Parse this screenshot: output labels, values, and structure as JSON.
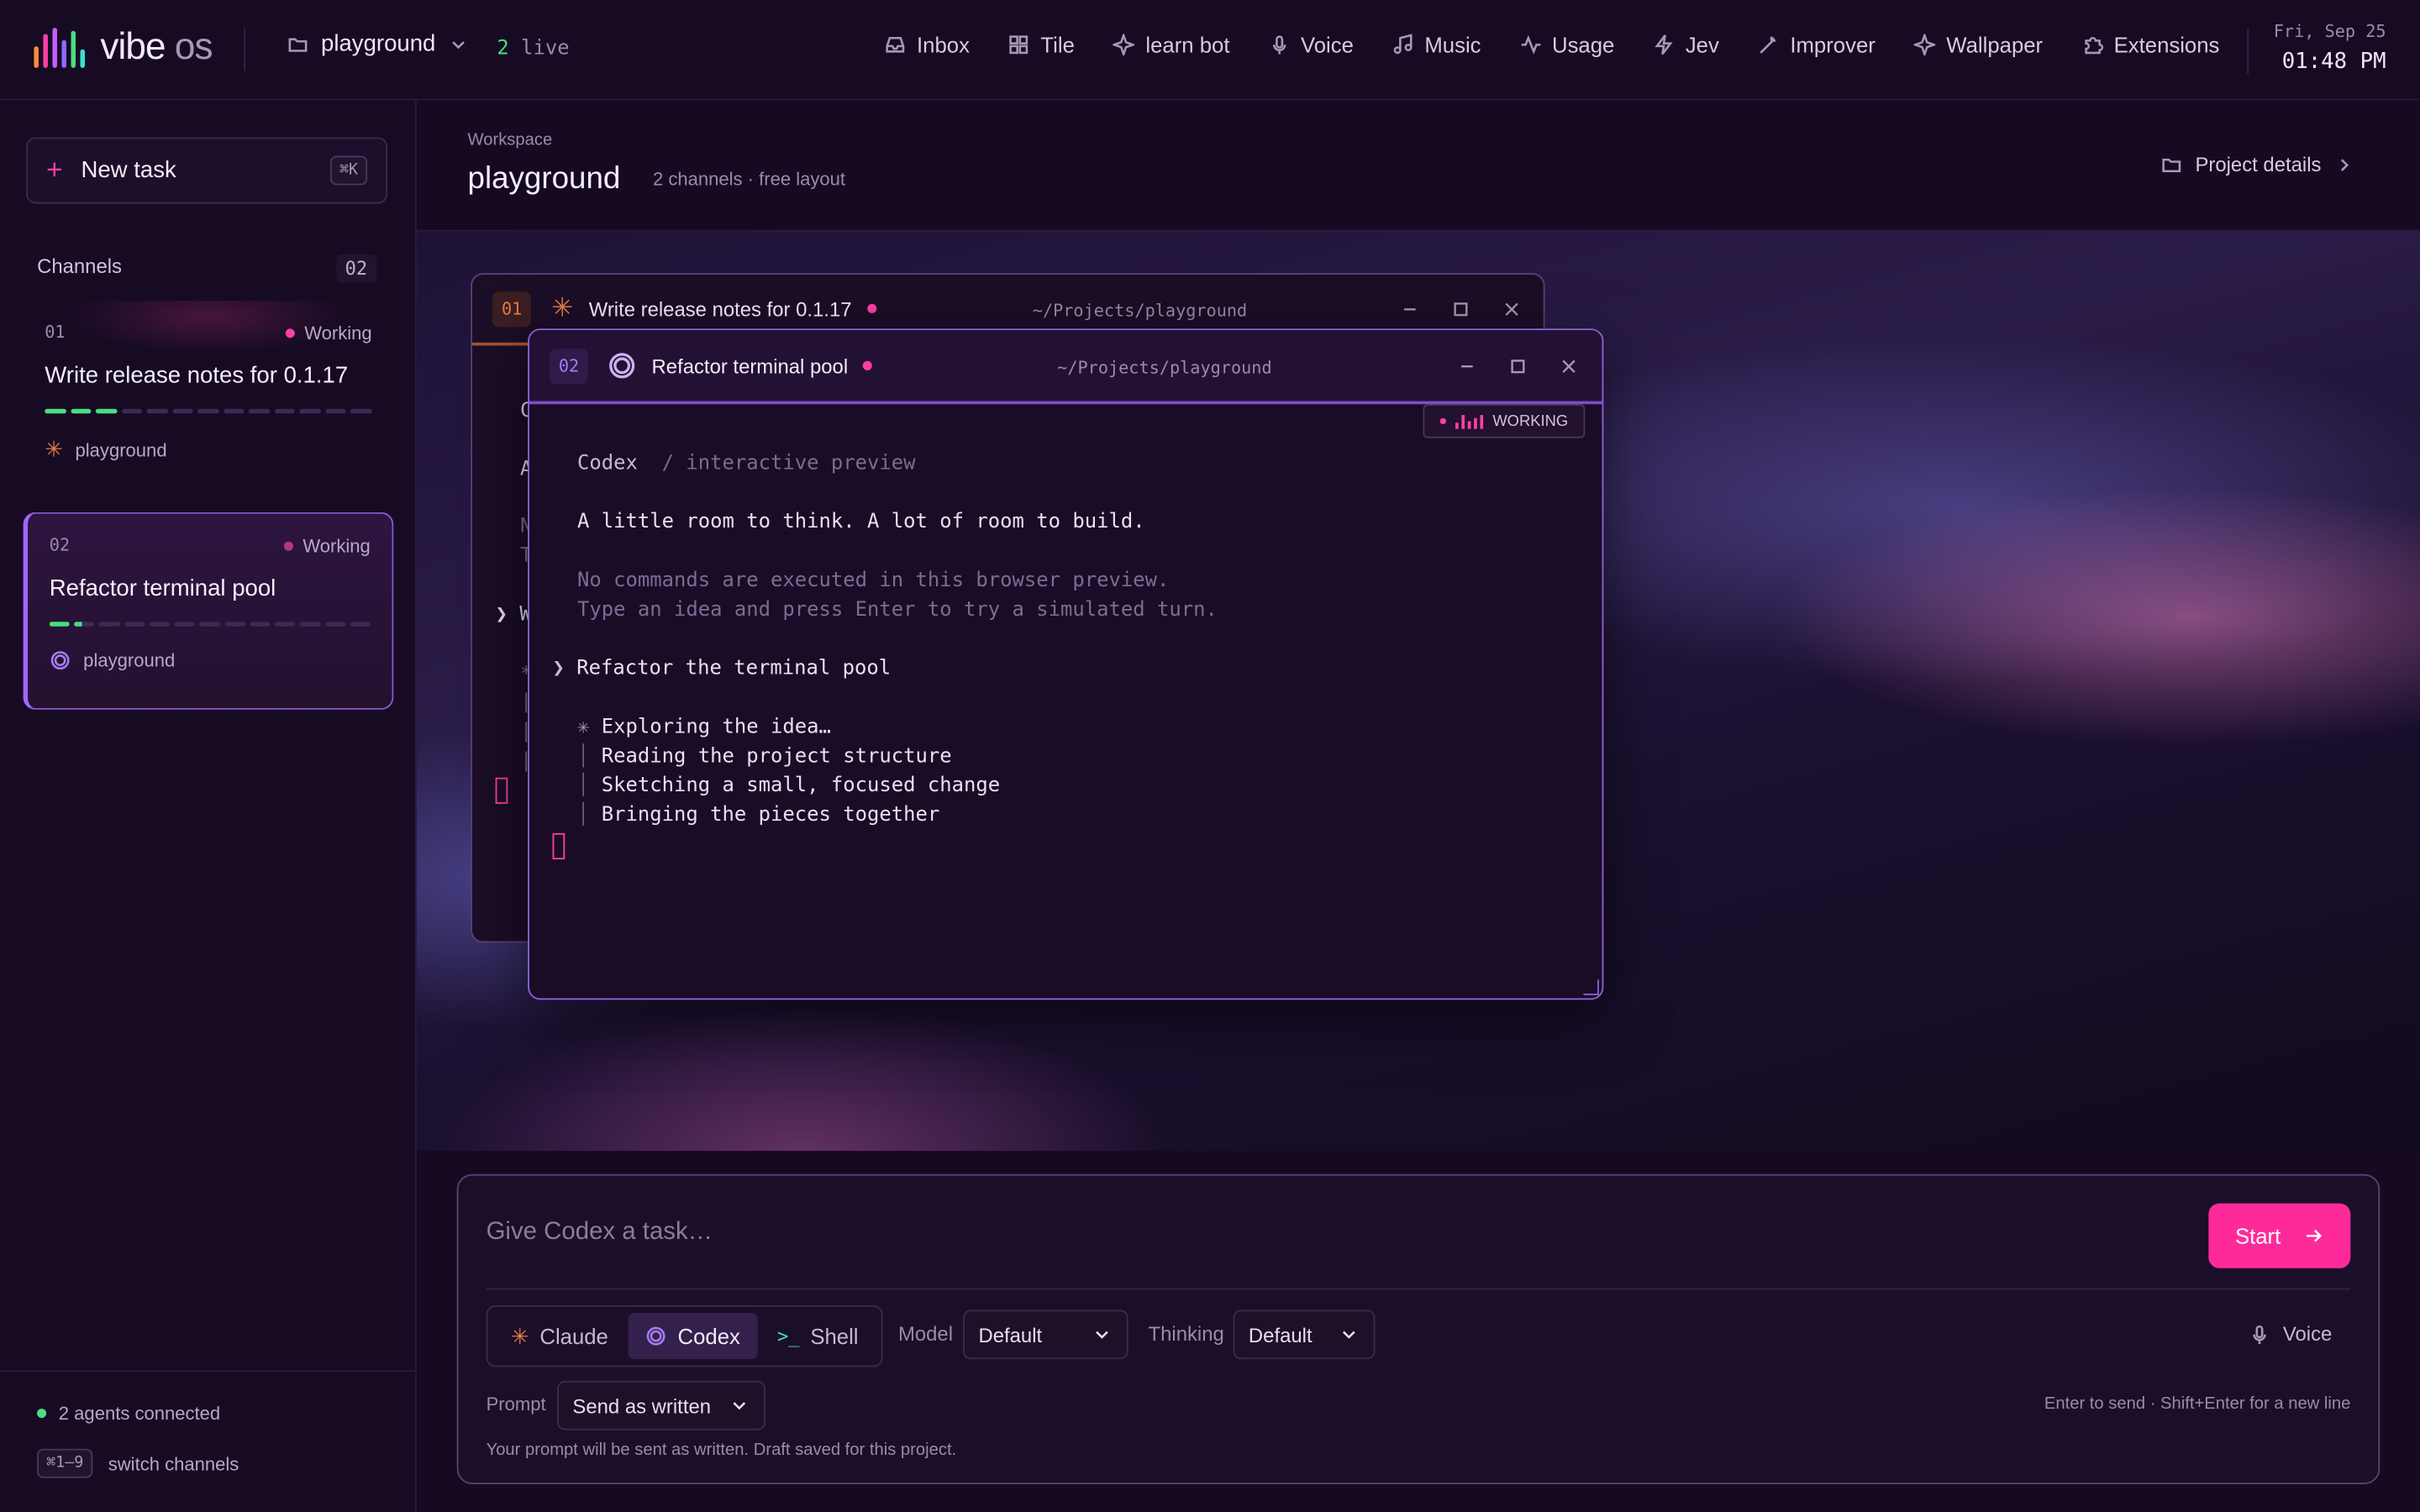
{
  "brand": {
    "name": "vibe",
    "suffix": "os",
    "accent": "#ff3fa4"
  },
  "topbar": {
    "project": "playground",
    "live_count": "2",
    "live_label": "live",
    "nav": [
      {
        "label": "Inbox",
        "icon": "inbox-icon"
      },
      {
        "label": "Tile",
        "icon": "grid-icon"
      },
      {
        "label": "learn bot",
        "icon": "sparkle-icon"
      },
      {
        "label": "Voice",
        "icon": "mic-icon"
      },
      {
        "label": "Music",
        "icon": "music-icon"
      },
      {
        "label": "Usage",
        "icon": "activity-icon"
      },
      {
        "label": "Jev",
        "icon": "bolt-icon"
      },
      {
        "label": "Improver",
        "icon": "wand-icon"
      },
      {
        "label": "Wallpaper",
        "icon": "sparkle-icon"
      },
      {
        "label": "Extensions",
        "icon": "puzzle-icon"
      }
    ],
    "date": "Fri, Sep 25",
    "time": "01:48 PM"
  },
  "sidebar": {
    "new_task": "New task",
    "new_task_shortcut": "⌘K",
    "channels_label": "Channels",
    "channels_count": "02",
    "channels": [
      {
        "num": "01",
        "status": "Working",
        "title": "Write release notes for 0.1.17",
        "progress_done": 3,
        "progress_total": 13,
        "project": "playground",
        "agent": "claude"
      },
      {
        "num": "02",
        "status": "Working",
        "title": "Refactor terminal pool",
        "progress_done": 1.5,
        "progress_total": 13,
        "project": "playground",
        "agent": "codex"
      }
    ],
    "agents_connected": "2 agents connected",
    "switch_shortcut": "⌘1–9",
    "switch_label": "switch channels"
  },
  "header": {
    "eyebrow": "Workspace",
    "name": "playground",
    "meta": "2 channels · free layout",
    "details": "Project details"
  },
  "windows": [
    {
      "num": "01",
      "title": "Write release notes for 0.1.17",
      "path": "~/Projects/playground",
      "partial_lines": [
        "C",
        "A",
        "N",
        "T",
        "❯ W",
        "*",
        "|",
        "|",
        "|"
      ]
    },
    {
      "num": "02",
      "title": "Refactor terminal pool",
      "path": "~/Projects/playground",
      "badge": "WORKING",
      "agent": "Codex",
      "mode": "/ interactive preview",
      "tagline": "A little room to think. A lot of room to build.",
      "note1": "No commands are executed in this browser preview.",
      "note2": "Type an idea and press Enter to try a simulated turn.",
      "prompt": "Refactor the terminal pool",
      "exploring": "Exploring the idea…",
      "steps": [
        "Reading the project structure",
        "Sketching a small, focused change",
        "Bringing the pieces together"
      ]
    }
  ],
  "composer": {
    "placeholder": "Give Codex a task…",
    "start": "Start",
    "agents": [
      {
        "label": "Claude",
        "icon": "asterisk-icon",
        "selected": false
      },
      {
        "label": "Codex",
        "icon": "codex-icon",
        "selected": true
      },
      {
        "label": "Shell",
        "icon": "terminal-icon",
        "selected": false
      }
    ],
    "model_label": "Model",
    "model_value": "Default",
    "thinking_label": "Thinking",
    "thinking_value": "Default",
    "voice": "Voice",
    "prompt_label": "Prompt",
    "prompt_value": "Send as written",
    "hint": "Enter to send · Shift+Enter for a new line",
    "note": "Your prompt will be sent as written. Draft saved for this project."
  },
  "colors": {
    "working": "#ff3fa4",
    "progress": "#4ade80",
    "claude": "#e87b44",
    "codex": "#a57cf0",
    "shell": "#3ee0d0"
  }
}
